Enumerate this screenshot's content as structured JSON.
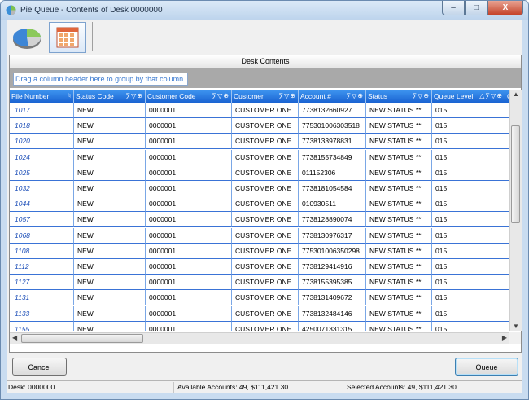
{
  "window": {
    "title": "Pie Queue - Contents of Desk 0000000",
    "minimize": "–",
    "maximize": "□",
    "close": "X"
  },
  "toolbar": {
    "icons": [
      "pie-chart-icon",
      "grid-view-icon"
    ]
  },
  "panel": {
    "caption": "Desk Contents",
    "group_hint": "Drag a column header here to group by that column."
  },
  "columns": [
    {
      "label": "File Number",
      "icons": "♮"
    },
    {
      "label": "Status Code",
      "icons": "∑▽⊕"
    },
    {
      "label": "Customer Code",
      "icons": "∑▽⊕"
    },
    {
      "label": "Customer",
      "icons": "∑▽⊕"
    },
    {
      "label": "Account #",
      "icons": "∑▽⊕"
    },
    {
      "label": "Status",
      "icons": "∑▽⊕"
    },
    {
      "label": "Queue Level",
      "icons": "△∑▽⊕"
    },
    {
      "label": "Qu",
      "icons": ""
    }
  ],
  "rows": [
    [
      "1017",
      "NEW",
      "0000001",
      "CUSTOMER ONE",
      "7738132660927",
      "NEW STATUS **",
      "015",
      "NE"
    ],
    [
      "1018",
      "NEW",
      "0000001",
      "CUSTOMER ONE",
      "775301006303518",
      "NEW STATUS **",
      "015",
      "NE"
    ],
    [
      "1020",
      "NEW",
      "0000001",
      "CUSTOMER ONE",
      "7738133978831",
      "NEW STATUS **",
      "015",
      "NE"
    ],
    [
      "1024",
      "NEW",
      "0000001",
      "CUSTOMER ONE",
      "7738155734849",
      "NEW STATUS **",
      "015",
      "NE"
    ],
    [
      "1025",
      "NEW",
      "0000001",
      "CUSTOMER ONE",
      "011152306",
      "NEW STATUS **",
      "015",
      "NE"
    ],
    [
      "1032",
      "NEW",
      "0000001",
      "CUSTOMER ONE",
      "7738181054584",
      "NEW STATUS **",
      "015",
      "NE"
    ],
    [
      "1044",
      "NEW",
      "0000001",
      "CUSTOMER ONE",
      "010930511",
      "NEW STATUS **",
      "015",
      "NE"
    ],
    [
      "1057",
      "NEW",
      "0000001",
      "CUSTOMER ONE",
      "7738128890074",
      "NEW STATUS **",
      "015",
      "NE"
    ],
    [
      "1068",
      "NEW",
      "0000001",
      "CUSTOMER ONE",
      "7738130976317",
      "NEW STATUS **",
      "015",
      "NE"
    ],
    [
      "1108",
      "NEW",
      "0000001",
      "CUSTOMER ONE",
      "775301006350298",
      "NEW STATUS **",
      "015",
      "NE"
    ],
    [
      "1112",
      "NEW",
      "0000001",
      "CUSTOMER ONE",
      "7738129414916",
      "NEW STATUS **",
      "015",
      "NE"
    ],
    [
      "1127",
      "NEW",
      "0000001",
      "CUSTOMER ONE",
      "7738155395385",
      "NEW STATUS **",
      "015",
      "NE"
    ],
    [
      "1131",
      "NEW",
      "0000001",
      "CUSTOMER ONE",
      "7738131409672",
      "NEW STATUS **",
      "015",
      "NE"
    ],
    [
      "1133",
      "NEW",
      "0000001",
      "CUSTOMER ONE",
      "7738132484146",
      "NEW STATUS **",
      "015",
      "NE"
    ],
    [
      "1155",
      "NEW",
      "0000001",
      "CUSTOMER ONE",
      "4250071331315",
      "NEW STATUS **",
      "015",
      "NE"
    ]
  ],
  "buttons": {
    "cancel": "Cancel",
    "queue": "Queue"
  },
  "statusbar": {
    "desk": "Desk: 0000000",
    "available": "Available Accounts: 49, $111,421.30",
    "selected": "Selected Accounts: 49, $111,421.30"
  },
  "colors": {
    "header": "#1a63d2",
    "link": "#1d4fb8"
  }
}
